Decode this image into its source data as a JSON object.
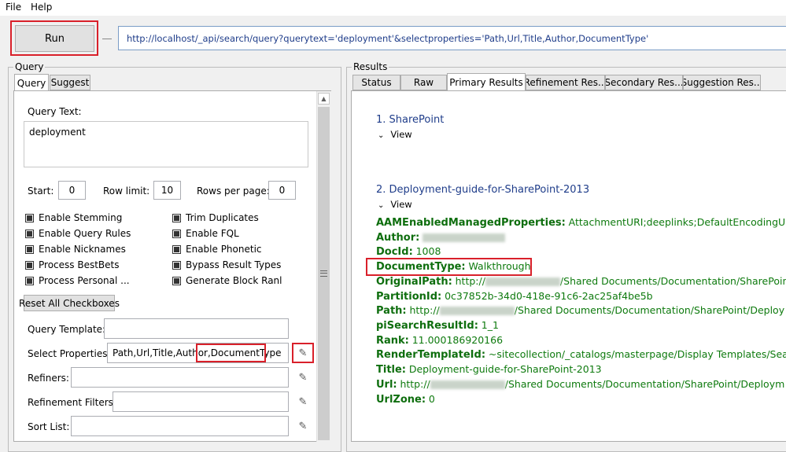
{
  "menu": {
    "file": "File",
    "help": "Help"
  },
  "toolbar": {
    "run_label": "Run",
    "url": "http://localhost/_api/search/query?querytext='deployment'&selectproperties='Path,Url,Title,Author,DocumentType'"
  },
  "query_panel": {
    "group_label": "Query",
    "tabs": [
      "Query",
      "Suggest"
    ],
    "query_text_label": "Query Text:",
    "query_text_value": "deployment",
    "start_label": "Start:",
    "start_value": "0",
    "row_limit_label": "Row limit:",
    "row_limit_value": "10",
    "rows_per_page_label": "Rows per page:",
    "rows_per_page_value": "0",
    "checkboxes_left": [
      "Enable Stemming",
      "Enable Query Rules",
      "Enable Nicknames",
      "Process BestBets",
      "Process Personal ..."
    ],
    "checkboxes_right": [
      "Trim Duplicates",
      "Enable FQL",
      "Enable Phonetic",
      "Bypass Result Types",
      "Generate Block Ranl"
    ],
    "reset_label": "Reset All Checkboxes",
    "query_template_label": "Query Template:",
    "query_template_value": "",
    "select_properties_label": "Select Properties:",
    "select_properties_value_a": "Path,Url,Title,Author,",
    "select_properties_value_b": "DocumentType",
    "refiners_label": "Refiners:",
    "refiners_value": "",
    "refinement_filters_label": "Refinement Filters:",
    "refinement_filters_value": "",
    "sort_list_label": "Sort List:",
    "sort_list_value": ""
  },
  "results_panel": {
    "group_label": "Results",
    "tabs": [
      "Status",
      "Raw",
      "Primary Results",
      "Refinement Res...",
      "Secondary Res...",
      "Suggestion Res..."
    ],
    "results": [
      {
        "title": "1. SharePoint",
        "view_label": "View"
      },
      {
        "title": "2. Deployment-guide-for-SharePoint-2013",
        "view_label": "View"
      }
    ],
    "properties": [
      {
        "name": "AAMEnabledManagedProperties:",
        "value": "AttachmentURI;deeplinks;DefaultEncodingURL;E"
      },
      {
        "name": "Author:",
        "value": ""
      },
      {
        "name": "DocId:",
        "value": "1008"
      },
      {
        "name": "DocumentType:",
        "value": "Walkthrough"
      },
      {
        "name": "OriginalPath:",
        "value": "http://",
        "value2": "/Shared Documents/Documentation/SharePoint"
      },
      {
        "name": "PartitionId:",
        "value": "0c37852b-34d0-418e-91c6-2ac25af4be5b"
      },
      {
        "name": "Path:",
        "value": "http://",
        "value2": "/Shared Documents/Documentation/SharePoint/Deploy"
      },
      {
        "name": "piSearchResultId:",
        "value": "1_1"
      },
      {
        "name": "Rank:",
        "value": "11.000186920166"
      },
      {
        "name": "RenderTemplateId:",
        "value": "~sitecollection/_catalogs/masterpage/Display Templates/Search"
      },
      {
        "name": "Title:",
        "value": "Deployment-guide-for-SharePoint-2013"
      },
      {
        "name": "Url:",
        "value": "http://",
        "value2": "/Shared Documents/Documentation/SharePoint/Deploym"
      },
      {
        "name": "UrlZone:",
        "value": "0"
      }
    ]
  },
  "colors": {
    "highlight": "#d9202a",
    "prop_name": "#0e6e0e",
    "link_blue": "#1f3d8a"
  }
}
